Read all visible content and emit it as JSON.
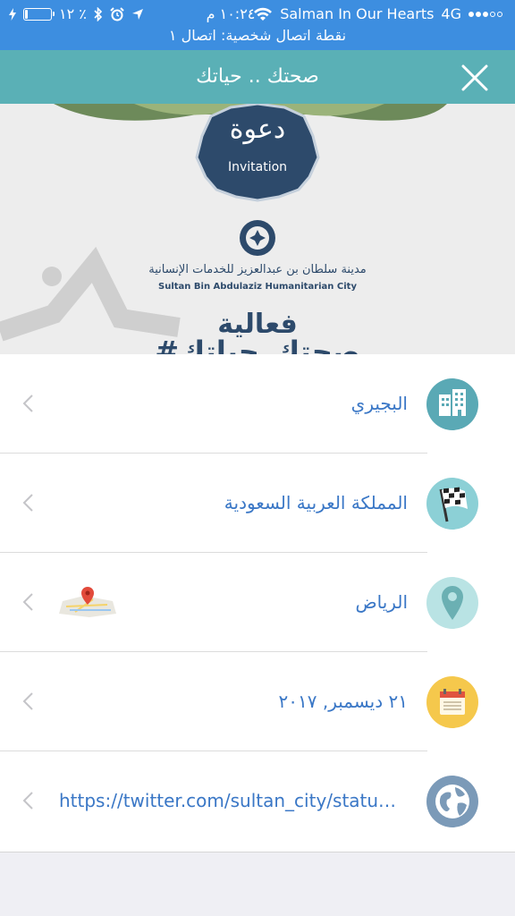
{
  "status_bar": {
    "carrier": "Salman In Our Hearts",
    "network": "4G",
    "time": "١٠:٢٤ م",
    "battery_percent": "٪ ١٢",
    "battery_level": 0.12,
    "hotspot_text": "نقطة اتصال شخصية: اتصال ١"
  },
  "nav": {
    "title": "صحتك .. حياتك",
    "close_icon": "close-icon",
    "color": "#5ab0b6"
  },
  "hero": {
    "badge_title": "دعوة",
    "badge_subtitle": "Invitation",
    "org_name_ar": "مدينة سلطان بن عبدالعزيز للخدمات الإنسانية",
    "org_name_en": "Sultan Bin Abdulaziz Humanitarian City",
    "event_label": "فعالية",
    "event_hashtag": "#صحتك_حياتك"
  },
  "details": [
    {
      "label": "البجيري",
      "icon": "building-icon",
      "icon_color": "#5aa9b5"
    },
    {
      "label": "المملكة العربية السعودية",
      "icon": "checkered-flag-icon",
      "icon_color": "#8cd0d6"
    },
    {
      "label": "الرياض",
      "icon": "map-pin-icon",
      "icon_color": "#b9e3e4",
      "has_map_thumbnail": true
    },
    {
      "label": "٢١ ديسمبر, ٢٠١٧",
      "icon": "calendar-icon",
      "icon_color": "#f5c84c"
    },
    {
      "label": "https://twitter.com/sultan_city/statu…",
      "icon": "globe-icon",
      "icon_color": "#7b9ab8"
    }
  ],
  "colors": {
    "status_bar": "#3d8ee0",
    "link_text": "#3a77c6",
    "background": "#efeff4"
  }
}
